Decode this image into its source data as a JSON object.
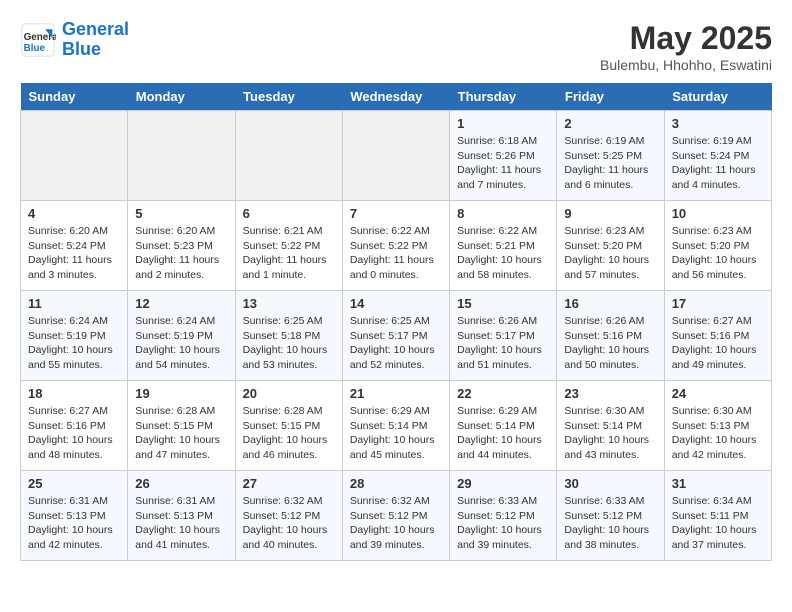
{
  "header": {
    "logo_line1": "General",
    "logo_line2": "Blue",
    "month_year": "May 2025",
    "location": "Bulembu, Hhohho, Eswatini"
  },
  "weekdays": [
    "Sunday",
    "Monday",
    "Tuesday",
    "Wednesday",
    "Thursday",
    "Friday",
    "Saturday"
  ],
  "weeks": [
    [
      {
        "day": "",
        "info": ""
      },
      {
        "day": "",
        "info": ""
      },
      {
        "day": "",
        "info": ""
      },
      {
        "day": "",
        "info": ""
      },
      {
        "day": "1",
        "info": "Sunrise: 6:18 AM\nSunset: 5:26 PM\nDaylight: 11 hours\nand 7 minutes."
      },
      {
        "day": "2",
        "info": "Sunrise: 6:19 AM\nSunset: 5:25 PM\nDaylight: 11 hours\nand 6 minutes."
      },
      {
        "day": "3",
        "info": "Sunrise: 6:19 AM\nSunset: 5:24 PM\nDaylight: 11 hours\nand 4 minutes."
      }
    ],
    [
      {
        "day": "4",
        "info": "Sunrise: 6:20 AM\nSunset: 5:24 PM\nDaylight: 11 hours\nand 3 minutes."
      },
      {
        "day": "5",
        "info": "Sunrise: 6:20 AM\nSunset: 5:23 PM\nDaylight: 11 hours\nand 2 minutes."
      },
      {
        "day": "6",
        "info": "Sunrise: 6:21 AM\nSunset: 5:22 PM\nDaylight: 11 hours\nand 1 minute."
      },
      {
        "day": "7",
        "info": "Sunrise: 6:22 AM\nSunset: 5:22 PM\nDaylight: 11 hours\nand 0 minutes."
      },
      {
        "day": "8",
        "info": "Sunrise: 6:22 AM\nSunset: 5:21 PM\nDaylight: 10 hours\nand 58 minutes."
      },
      {
        "day": "9",
        "info": "Sunrise: 6:23 AM\nSunset: 5:20 PM\nDaylight: 10 hours\nand 57 minutes."
      },
      {
        "day": "10",
        "info": "Sunrise: 6:23 AM\nSunset: 5:20 PM\nDaylight: 10 hours\nand 56 minutes."
      }
    ],
    [
      {
        "day": "11",
        "info": "Sunrise: 6:24 AM\nSunset: 5:19 PM\nDaylight: 10 hours\nand 55 minutes."
      },
      {
        "day": "12",
        "info": "Sunrise: 6:24 AM\nSunset: 5:19 PM\nDaylight: 10 hours\nand 54 minutes."
      },
      {
        "day": "13",
        "info": "Sunrise: 6:25 AM\nSunset: 5:18 PM\nDaylight: 10 hours\nand 53 minutes."
      },
      {
        "day": "14",
        "info": "Sunrise: 6:25 AM\nSunset: 5:17 PM\nDaylight: 10 hours\nand 52 minutes."
      },
      {
        "day": "15",
        "info": "Sunrise: 6:26 AM\nSunset: 5:17 PM\nDaylight: 10 hours\nand 51 minutes."
      },
      {
        "day": "16",
        "info": "Sunrise: 6:26 AM\nSunset: 5:16 PM\nDaylight: 10 hours\nand 50 minutes."
      },
      {
        "day": "17",
        "info": "Sunrise: 6:27 AM\nSunset: 5:16 PM\nDaylight: 10 hours\nand 49 minutes."
      }
    ],
    [
      {
        "day": "18",
        "info": "Sunrise: 6:27 AM\nSunset: 5:16 PM\nDaylight: 10 hours\nand 48 minutes."
      },
      {
        "day": "19",
        "info": "Sunrise: 6:28 AM\nSunset: 5:15 PM\nDaylight: 10 hours\nand 47 minutes."
      },
      {
        "day": "20",
        "info": "Sunrise: 6:28 AM\nSunset: 5:15 PM\nDaylight: 10 hours\nand 46 minutes."
      },
      {
        "day": "21",
        "info": "Sunrise: 6:29 AM\nSunset: 5:14 PM\nDaylight: 10 hours\nand 45 minutes."
      },
      {
        "day": "22",
        "info": "Sunrise: 6:29 AM\nSunset: 5:14 PM\nDaylight: 10 hours\nand 44 minutes."
      },
      {
        "day": "23",
        "info": "Sunrise: 6:30 AM\nSunset: 5:14 PM\nDaylight: 10 hours\nand 43 minutes."
      },
      {
        "day": "24",
        "info": "Sunrise: 6:30 AM\nSunset: 5:13 PM\nDaylight: 10 hours\nand 42 minutes."
      }
    ],
    [
      {
        "day": "25",
        "info": "Sunrise: 6:31 AM\nSunset: 5:13 PM\nDaylight: 10 hours\nand 42 minutes."
      },
      {
        "day": "26",
        "info": "Sunrise: 6:31 AM\nSunset: 5:13 PM\nDaylight: 10 hours\nand 41 minutes."
      },
      {
        "day": "27",
        "info": "Sunrise: 6:32 AM\nSunset: 5:12 PM\nDaylight: 10 hours\nand 40 minutes."
      },
      {
        "day": "28",
        "info": "Sunrise: 6:32 AM\nSunset: 5:12 PM\nDaylight: 10 hours\nand 39 minutes."
      },
      {
        "day": "29",
        "info": "Sunrise: 6:33 AM\nSunset: 5:12 PM\nDaylight: 10 hours\nand 39 minutes."
      },
      {
        "day": "30",
        "info": "Sunrise: 6:33 AM\nSunset: 5:12 PM\nDaylight: 10 hours\nand 38 minutes."
      },
      {
        "day": "31",
        "info": "Sunrise: 6:34 AM\nSunset: 5:11 PM\nDaylight: 10 hours\nand 37 minutes."
      }
    ]
  ]
}
